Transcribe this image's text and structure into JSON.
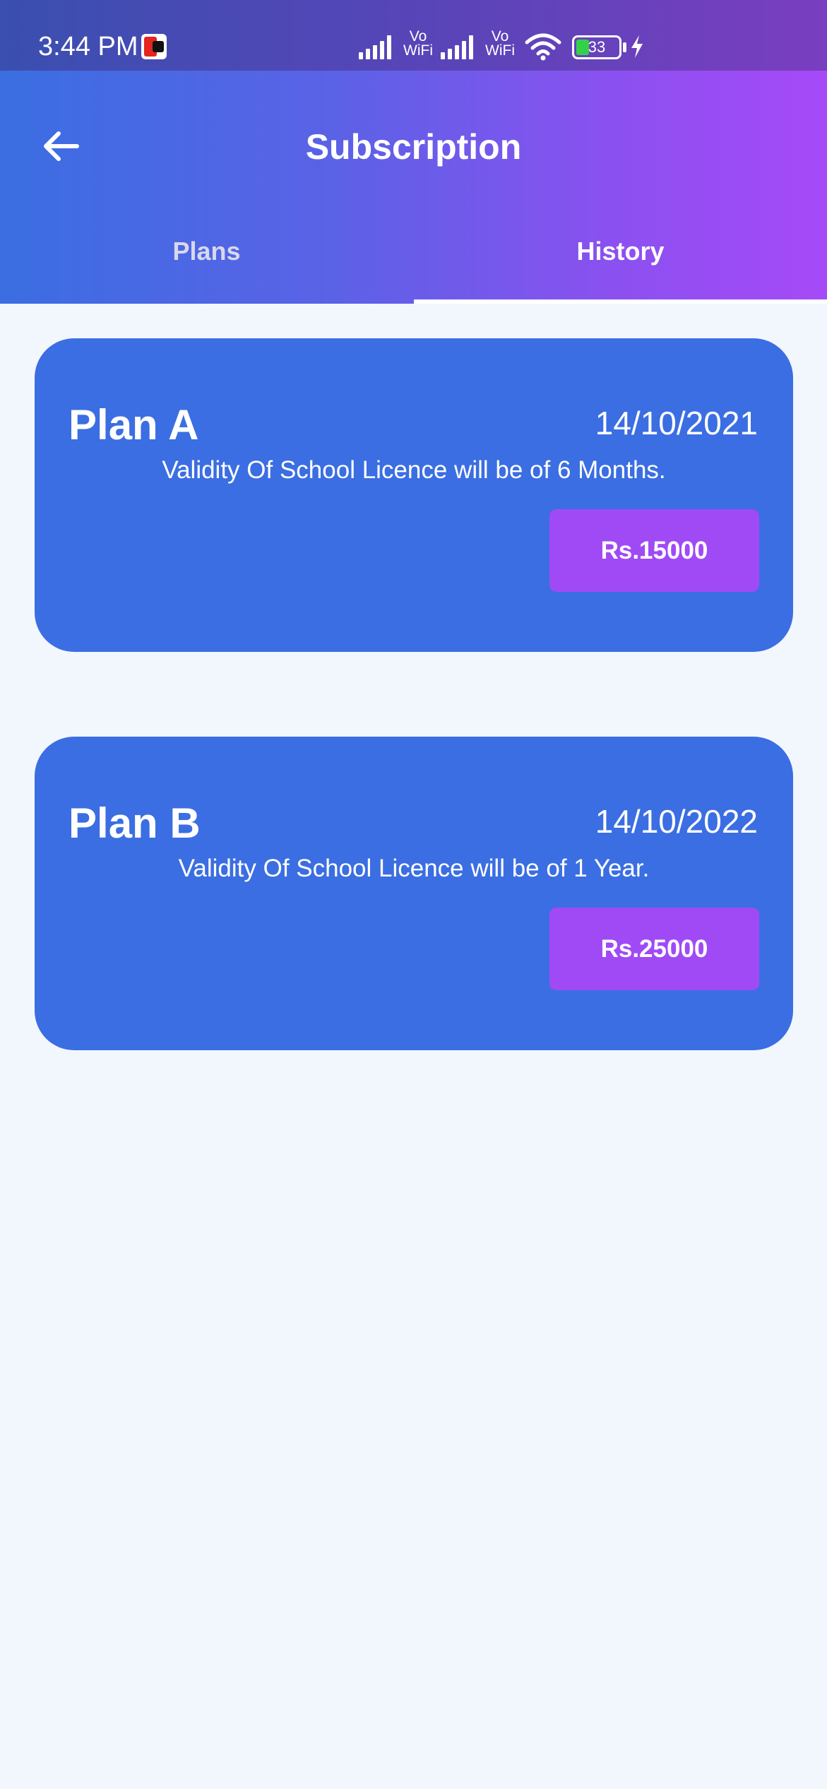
{
  "status_bar": {
    "time": "3:44 PM",
    "network_label_1": "Vo\nWiFi",
    "network_label_2": "Vo\nWiFi",
    "battery_level": "33",
    "icons": [
      "app-notification-icon",
      "signal-icon",
      "signal-icon",
      "wifi-icon",
      "battery-icon",
      "charging-icon"
    ]
  },
  "app_bar": {
    "title": "Subscription",
    "back_icon": "arrow-left-icon"
  },
  "tabs": [
    {
      "label": "Plans",
      "selected": false
    },
    {
      "label": "History",
      "selected": true
    }
  ],
  "plans": [
    {
      "name": "Plan A",
      "date": "14/10/2021",
      "description": "Validity Of School Licence will be of 6 Months.",
      "price": "Rs.15000"
    },
    {
      "name": "Plan B",
      "date": "14/10/2022",
      "description": "Validity Of School Licence will be of 1 Year.",
      "price": "Rs.25000"
    }
  ],
  "colors": {
    "appbar_start": "#3b6ee2",
    "appbar_end": "#a64af8",
    "card_bg": "#3b6ee2",
    "price_button_bg": "#a04af6",
    "page_bg": "#f2f7fe"
  }
}
